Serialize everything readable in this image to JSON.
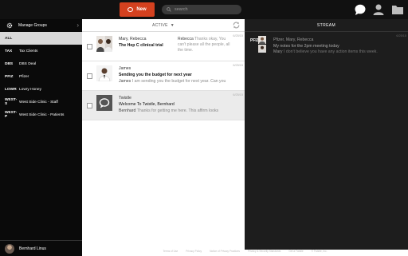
{
  "topbar": {
    "new_label": "New",
    "search_placeholder": "search",
    "icons": [
      "chat-icon",
      "user-icon",
      "folder-icon"
    ]
  },
  "sidebar": {
    "manage_groups_label": "Manage Groups",
    "groups": [
      {
        "abbr": "ALL",
        "name": ""
      },
      {
        "abbr": "TAX",
        "name": "Tax Clients"
      },
      {
        "abbr": "DBS",
        "name": "DBS Deal"
      },
      {
        "abbr": "PFIZ",
        "name": "Pfizer"
      },
      {
        "abbr": "LOWR",
        "name": "Lowry Honey"
      },
      {
        "abbr": "WEST-S",
        "name": "West Side Clinic - Staff"
      },
      {
        "abbr": "WEST-P",
        "name": "West Side Clinic - Patients"
      }
    ],
    "user_name": "Bernhard Linus"
  },
  "list": {
    "header_label": "ACTIVE",
    "messages": [
      {
        "from": "Mary, Rebecca",
        "subject": "The Hep C clinical trial",
        "preview_name": "Rebecca",
        "preview_text": "Thanks okay, You can't please all the people, all the time.",
        "date": "6/25/15"
      },
      {
        "from": "James",
        "subject": "Sending you the budget for next year",
        "preview_name": "James",
        "preview_text": "I am sending you the budget for next year. Can you",
        "date": "6/25/15"
      },
      {
        "from": "Twistle",
        "subject": "Welcome To Twistle, Bernhard",
        "preview_name": "Bernhard",
        "preview_text": "Thanks for getting me here. This affirm looks",
        "date": "6/25/15"
      }
    ]
  },
  "stream": {
    "header_label": "STREAM",
    "item": {
      "tag": "PFIZ",
      "from": "Pfizer, Mary, Rebecca",
      "text": "My notes for the 2pm meeting today",
      "preview_name": "Mary",
      "preview_text": "I don't believe you have any action items this week.",
      "date": "6/25/15"
    }
  },
  "footer_links": [
    "Terms of Use",
    "Privacy Policy",
    "Notice of Privacy Practices",
    "Privacy & Security Standards",
    "Get a Twistle",
    "© Twistle, Inc."
  ],
  "colors": {
    "accent": "#d4411f",
    "topbar": "#111111",
    "sidebar": "#0a0a0a",
    "stream_bg": "#1d1d1d",
    "selected_group": "#d9d9d9"
  }
}
